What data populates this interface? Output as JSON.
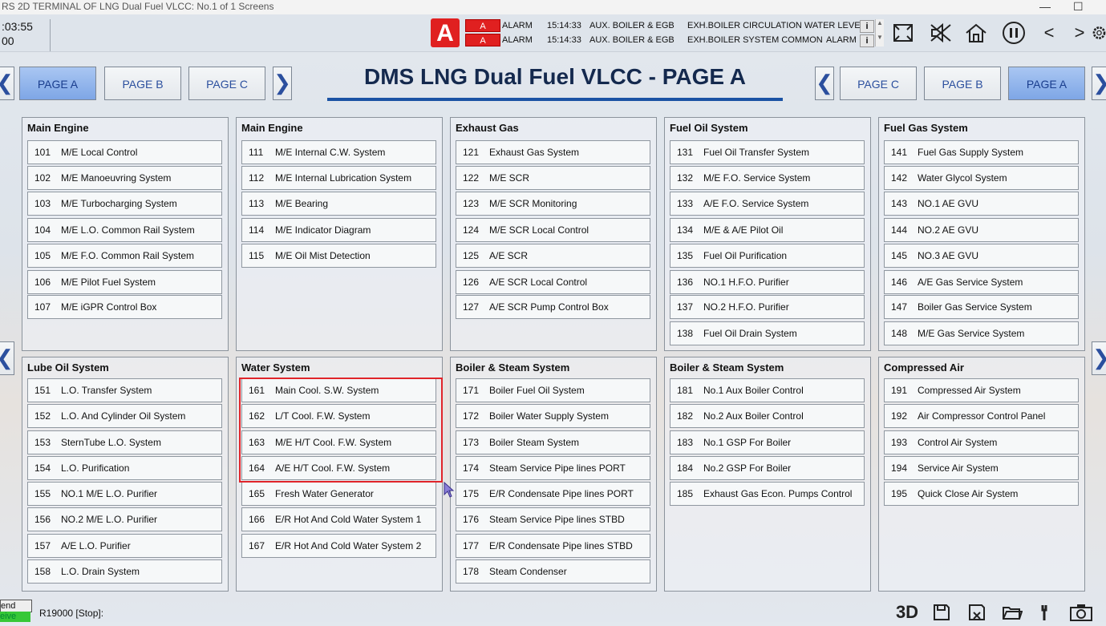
{
  "window": {
    "title": "RS 2D TERMINAL OF LNG Dual Fuel VLCC: No.1 of 1 Screens",
    "minimize": "—",
    "maximize": "☐"
  },
  "clock": {
    "time": ":03:55",
    "sub": "00"
  },
  "alarm_indicator": "A",
  "alarms": [
    {
      "flag": "A",
      "type": "ALARM",
      "time": "15:14:33",
      "group": "AUX. BOILER & EGB",
      "text": "EXH.BOILER CIRCULATION WATER LEVEL"
    },
    {
      "flag": "A",
      "type": "ALARM",
      "time": "15:14:33",
      "group": "AUX. BOILER & EGB",
      "text": "EXH.BOILER SYSTEM COMMON",
      "suffix": "ALARM"
    }
  ],
  "info_button": "i",
  "toolbar": {
    "prev": "<",
    "next": ">"
  },
  "page_title": "DMS LNG Dual Fuel VLCC - PAGE A",
  "nav_left": {
    "tabs": [
      "PAGE A",
      "PAGE B",
      "PAGE C"
    ],
    "active": "PAGE A"
  },
  "nav_right": {
    "tabs": [
      "PAGE C",
      "PAGE B",
      "PAGE A"
    ],
    "active": "PAGE A"
  },
  "panels": [
    {
      "title": "Main Engine",
      "items": [
        [
          "101",
          "M/E Local Control"
        ],
        [
          "102",
          "M/E Manoeuvring System"
        ],
        [
          "103",
          "M/E Turbocharging System"
        ],
        [
          "104",
          "M/E L.O. Common Rail System"
        ],
        [
          "105",
          "M/E F.O. Common Rail System"
        ],
        [
          "106",
          "M/E Pilot Fuel System"
        ],
        [
          "107",
          "M/E iGPR Control Box"
        ]
      ]
    },
    {
      "title": "Main Engine",
      "items": [
        [
          "111",
          "M/E Internal C.W. System"
        ],
        [
          "112",
          "M/E Internal Lubrication System"
        ],
        [
          "113",
          "M/E Bearing"
        ],
        [
          "114",
          "M/E Indicator Diagram"
        ],
        [
          "115",
          "M/E Oil Mist Detection"
        ]
      ]
    },
    {
      "title": "Exhaust Gas",
      "items": [
        [
          "121",
          "Exhaust Gas System"
        ],
        [
          "122",
          "M/E SCR"
        ],
        [
          "123",
          "M/E SCR Monitoring"
        ],
        [
          "124",
          "M/E SCR Local Control"
        ],
        [
          "125",
          "A/E SCR"
        ],
        [
          "126",
          "A/E SCR Local Control"
        ],
        [
          "127",
          "A/E SCR Pump Control Box"
        ]
      ]
    },
    {
      "title": "Fuel Oil System",
      "items": [
        [
          "131",
          "Fuel Oil Transfer System"
        ],
        [
          "132",
          "M/E F.O. Service System"
        ],
        [
          "133",
          "A/E F.O. Service System"
        ],
        [
          "134",
          "M/E & A/E Pilot Oil"
        ],
        [
          "135",
          "Fuel Oil Purification"
        ],
        [
          "136",
          "NO.1 H.F.O. Purifier"
        ],
        [
          "137",
          "NO.2 H.F.O. Purifier"
        ],
        [
          "138",
          "Fuel Oil Drain System"
        ]
      ]
    },
    {
      "title": "Fuel Gas System",
      "items": [
        [
          "141",
          "Fuel Gas Supply System"
        ],
        [
          "142",
          "Water Glycol System"
        ],
        [
          "143",
          "NO.1 AE GVU"
        ],
        [
          "144",
          "NO.2 AE GVU"
        ],
        [
          "145",
          "NO.3 AE GVU"
        ],
        [
          "146",
          "A/E Gas Service System"
        ],
        [
          "147",
          "Boiler Gas Service System"
        ],
        [
          "148",
          "M/E Gas Service System"
        ]
      ]
    },
    {
      "title": "Lube Oil System",
      "items": [
        [
          "151",
          "L.O. Transfer System"
        ],
        [
          "152",
          "L.O. And Cylinder Oil System"
        ],
        [
          "153",
          "SternTube L.O. System"
        ],
        [
          "154",
          "L.O. Purification"
        ],
        [
          "155",
          "NO.1 M/E L.O. Purifier"
        ],
        [
          "156",
          "NO.2 M/E L.O. Purifier"
        ],
        [
          "157",
          "A/E L.O. Purifier"
        ],
        [
          "158",
          "L.O. Drain System"
        ]
      ]
    },
    {
      "title": "Water System",
      "items": [
        [
          "161",
          "Main Cool. S.W. System"
        ],
        [
          "162",
          "L/T Cool. F.W. System"
        ],
        [
          "163",
          "M/E H/T Cool. F.W. System"
        ],
        [
          "164",
          "A/E H/T Cool. F.W. System"
        ],
        [
          "165",
          "Fresh Water Generator"
        ],
        [
          "166",
          "E/R Hot And Cold Water System 1"
        ],
        [
          "167",
          "E/R Hot And Cold Water System 2"
        ]
      ]
    },
    {
      "title": "Boiler & Steam System",
      "items": [
        [
          "171",
          "Boiler Fuel Oil System"
        ],
        [
          "172",
          "Boiler Water Supply System"
        ],
        [
          "173",
          "Boiler Steam System"
        ],
        [
          "174",
          "Steam Service Pipe lines PORT"
        ],
        [
          "175",
          "E/R Condensate Pipe lines PORT"
        ],
        [
          "176",
          "Steam Service Pipe lines STBD"
        ],
        [
          "177",
          "E/R Condensate Pipe lines STBD"
        ],
        [
          "178",
          "Steam Condenser"
        ]
      ]
    },
    {
      "title": "Boiler & Steam System",
      "items": [
        [
          "181",
          "No.1 Aux Boiler Control"
        ],
        [
          "182",
          "No.2 Aux Boiler Control"
        ],
        [
          "183",
          "No.1 GSP For Boiler"
        ],
        [
          "184",
          "No.2 GSP For Boiler"
        ],
        [
          "185",
          "Exhaust Gas Econ. Pumps Control"
        ]
      ]
    },
    {
      "title": "Compressed Air",
      "items": [
        [
          "191",
          "Compressed Air System"
        ],
        [
          "192",
          "Air Compressor Control Panel"
        ],
        [
          "193",
          "Control Air System"
        ],
        [
          "194",
          "Service Air System"
        ],
        [
          "195",
          "Quick Close Air System"
        ]
      ]
    }
  ],
  "status_bar": {
    "send": "end",
    "receive": "eive",
    "message": "R19000 [Stop]:",
    "label_3d": "3D"
  }
}
